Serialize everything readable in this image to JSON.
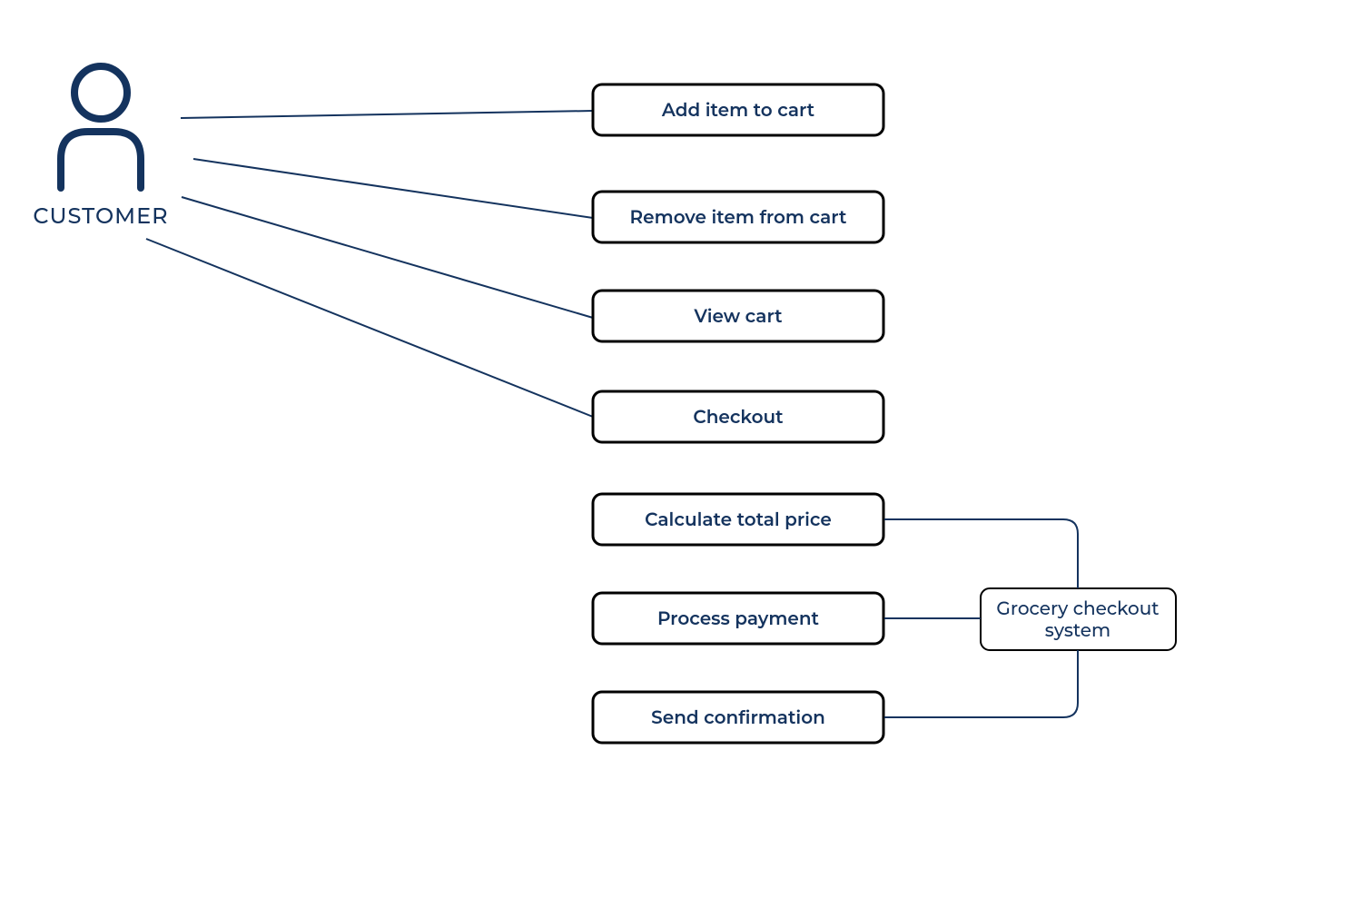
{
  "actor": {
    "label": "CUSTOMER"
  },
  "use_cases": [
    {
      "label": "Add item to cart"
    },
    {
      "label": "Remove item from cart"
    },
    {
      "label": "View cart"
    },
    {
      "label": "Checkout"
    },
    {
      "label": "Calculate total price"
    },
    {
      "label": "Process payment"
    },
    {
      "label": "Send confirmation"
    }
  ],
  "system": {
    "label_l1": "Grocery checkout",
    "label_l2": "system"
  },
  "colors": {
    "primary": "#14335e",
    "box_border": "#000000"
  }
}
